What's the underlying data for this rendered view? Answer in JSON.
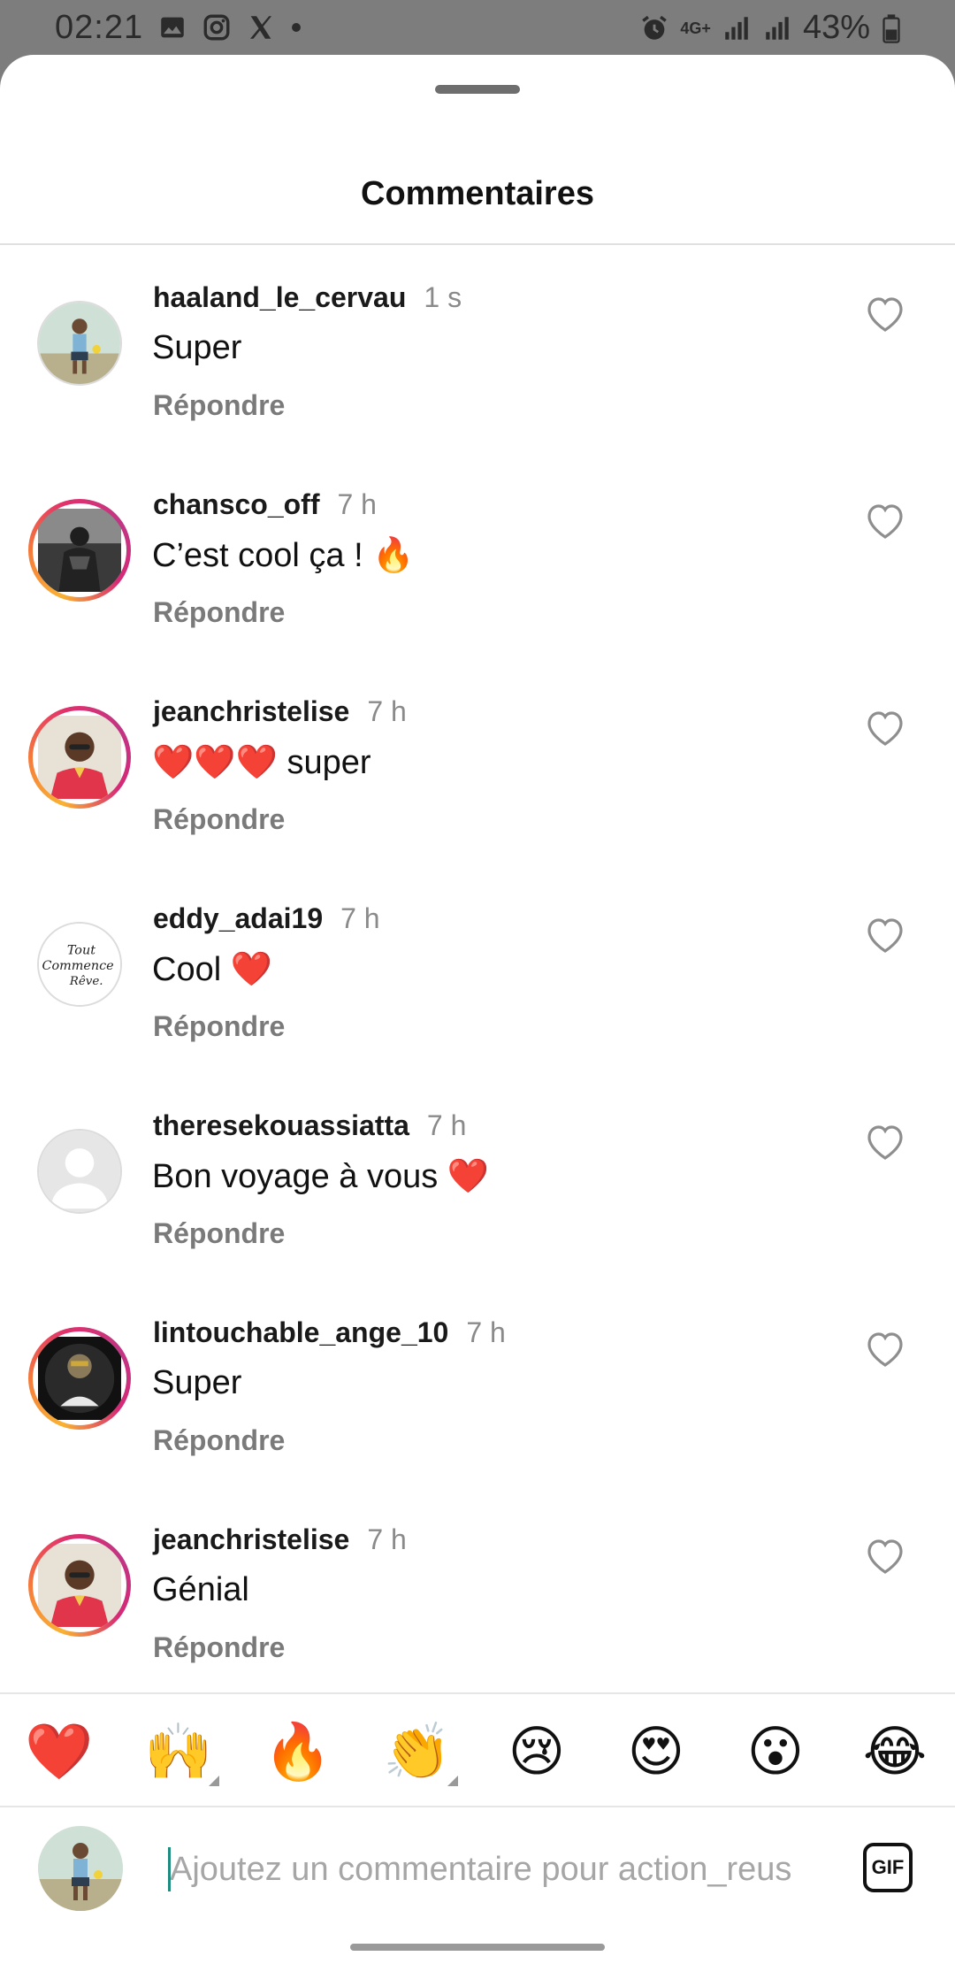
{
  "status_bar": {
    "time": "02:21",
    "battery": "43%",
    "network": "4G+",
    "left_icons": [
      "gallery-icon",
      "instagram-icon",
      "x-icon",
      "dot-icon"
    ],
    "right_icons": [
      "alarm-icon",
      "data-arrows-icon",
      "signal-icon",
      "signal-icon",
      "battery-icon"
    ]
  },
  "sheet": {
    "title": "Commentaires"
  },
  "comments": [
    {
      "username": "haaland_le_cervau",
      "time": "1 s",
      "text": "Super",
      "reply": "Répondre",
      "story_ring": false
    },
    {
      "username": "chansco_off",
      "time": "7 h",
      "text": "C’est cool ça ! 🔥",
      "reply": "Répondre",
      "story_ring": true
    },
    {
      "username": "jeanchristelise",
      "time": "7 h",
      "text": "❤️❤️❤️ super",
      "reply": "Répondre",
      "story_ring": true
    },
    {
      "username": "eddy_adai19",
      "time": "7 h",
      "text": "Cool ❤️",
      "reply": "Répondre",
      "story_ring": false,
      "avatar_text": "Tout Commence Rêve."
    },
    {
      "username": "theresekouassiatta",
      "time": "7 h",
      "text": "Bon  voyage à vous ❤️",
      "reply": "Répondre",
      "story_ring": false
    },
    {
      "username": "lintouchable_ange_10",
      "time": "7 h",
      "text": "Super",
      "reply": "Répondre",
      "story_ring": true
    },
    {
      "username": "jeanchristelise",
      "time": "7 h",
      "text": "Génial",
      "reply": "Répondre",
      "story_ring": true
    }
  ],
  "quick_reactions": [
    "❤️",
    "🙌",
    "🔥",
    "👏",
    "😢",
    "😍",
    "😮",
    "😂"
  ],
  "composer": {
    "placeholder": "Ajoutez un commentaire pour action_reus",
    "gif_label": "GIF"
  },
  "colors": {
    "accent_caret": "#1e8c7e",
    "story_ring_start": "#f9b233",
    "story_ring_end": "#c13584"
  }
}
